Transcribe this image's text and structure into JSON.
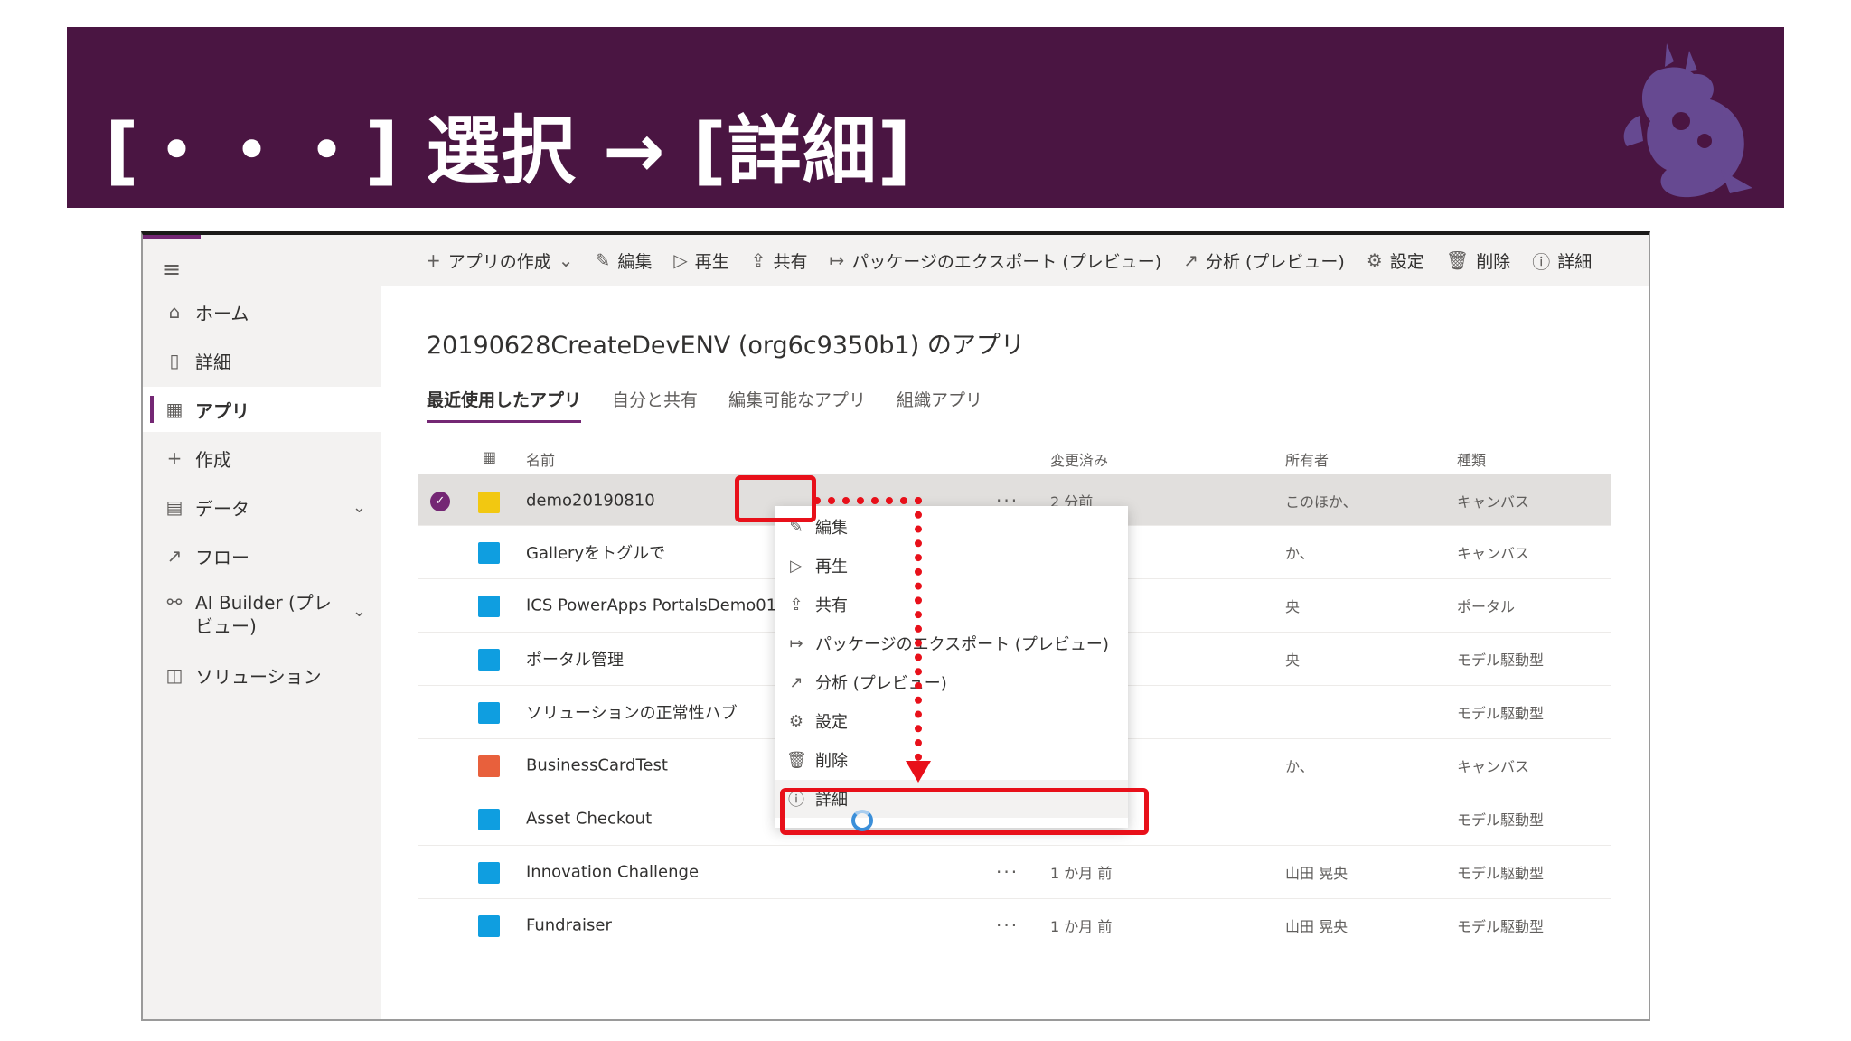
{
  "slide": {
    "title": "[・・・] 選択 → [詳細]"
  },
  "sidebar": {
    "items": [
      {
        "label": "ホーム",
        "icon": "home-icon"
      },
      {
        "label": "詳細",
        "icon": "book-icon"
      },
      {
        "label": "アプリ",
        "icon": "apps-icon",
        "active": true
      },
      {
        "label": "作成",
        "icon": "plus-icon"
      },
      {
        "label": "データ",
        "icon": "table-icon"
      },
      {
        "label": "フロー",
        "icon": "flow-icon"
      },
      {
        "label": "AI Builder (プレビュー)",
        "icon": "ai-builder-icon"
      },
      {
        "label": "ソリューション",
        "icon": "solution-icon"
      }
    ]
  },
  "command_bar": {
    "create": "アプリの作成",
    "edit": "編集",
    "play": "再生",
    "share": "共有",
    "export": "パッケージのエクスポート (プレビュー)",
    "analytics": "分析 (プレビュー)",
    "settings": "設定",
    "delete": "削除",
    "details": "詳細"
  },
  "page": {
    "title": "20190628CreateDevENV (org6c9350b1) のアプリ"
  },
  "tabs": [
    "最近使用したアプリ",
    "自分と共有",
    "編集可能なアプリ",
    "組織アプリ"
  ],
  "grid": {
    "headers": {
      "name": "名前",
      "modified": "変更済み",
      "owner": "所有者",
      "type": "種類"
    },
    "rows": [
      {
        "name": "demo20190810",
        "modified": "2 分前",
        "owner": "このほか、",
        "type": "キャンバス",
        "icon_color": "#f2c811"
      },
      {
        "name": "Galleryをトグルで",
        "modified": "",
        "owner": "か、",
        "type": "キャンバス",
        "icon_color": "#0f9ee0"
      },
      {
        "name": "ICS PowerApps PortalsDemo01",
        "modified": "",
        "owner": "央",
        "type": "ポータル",
        "icon_color": "#0f9ee0"
      },
      {
        "name": "ポータル管理",
        "modified": "",
        "owner": "央",
        "type": "モデル駆動型",
        "icon_color": "#0f9ee0"
      },
      {
        "name": "ソリューションの正常性ハブ",
        "modified": "",
        "owner": "",
        "type": "モデル駆動型",
        "icon_color": "#0f9ee0"
      },
      {
        "name": "BusinessCardTest",
        "modified": "",
        "owner": "か、",
        "type": "キャンバス",
        "icon_color": "#e8603c"
      },
      {
        "name": "Asset Checkout",
        "modified": "",
        "owner": "",
        "type": "モデル駆動型",
        "icon_color": "#0f9ee0"
      },
      {
        "name": "Innovation Challenge",
        "modified": "1 か月 前",
        "owner": "山田 晃央",
        "type": "モデル駆動型",
        "icon_color": "#0f9ee0"
      },
      {
        "name": "Fundraiser",
        "modified": "1 か月 前",
        "owner": "山田 晃央",
        "type": "モデル駆動型",
        "icon_color": "#0f9ee0"
      }
    ],
    "more_label": "···"
  },
  "context_menu": {
    "items": [
      {
        "label": "編集",
        "icon": "pencil-icon"
      },
      {
        "label": "再生",
        "icon": "play-icon"
      },
      {
        "label": "共有",
        "icon": "share-icon"
      },
      {
        "label": "パッケージのエクスポート (プレビュー)",
        "icon": "export-icon"
      },
      {
        "label": "分析 (プレビュー)",
        "icon": "analytics-icon"
      },
      {
        "label": "設定",
        "icon": "gear-icon"
      },
      {
        "label": "削除",
        "icon": "trash-icon"
      },
      {
        "label": "詳細",
        "icon": "info-icon"
      }
    ]
  },
  "colors": {
    "banner": "#4a1542",
    "accent": "#742774",
    "highlight": "#e8101a"
  }
}
